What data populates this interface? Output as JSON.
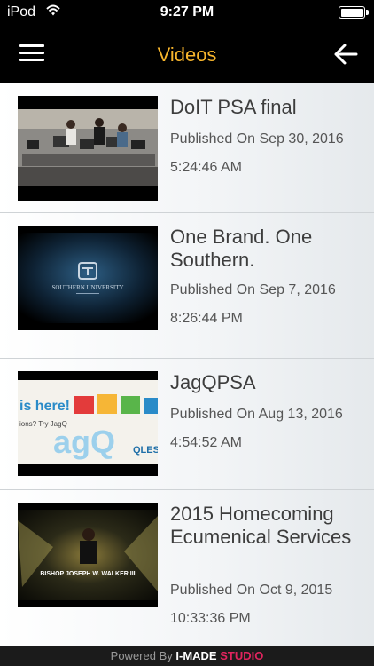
{
  "status": {
    "carrier": "iPod",
    "time": "9:27 PM"
  },
  "header": {
    "title": "Videos"
  },
  "videos": [
    {
      "title": "DoIT PSA final",
      "published": "Published On Sep 30, 2016",
      "time": "5:24:46 AM"
    },
    {
      "title": "One Brand. One Southern.",
      "published": "Published On Sep 7, 2016",
      "time": "8:26:44 PM",
      "thumb_text": "SOUTHERN UNIVERSITY"
    },
    {
      "title": "JagQPSA",
      "published": "Published On Aug 13, 2016",
      "time": "4:54:52 AM",
      "thumb_text": "QLES"
    },
    {
      "title": "2015 Homecoming Ecumenical Services",
      "published": "Published On Oct 9, 2015",
      "time": "10:33:36 PM",
      "thumb_text": "BISHOP JOSEPH W. WALKER III"
    }
  ],
  "footer": {
    "prefix": "Powered By",
    "brand1": "I-MADE",
    "brand2": "STUDIO"
  }
}
